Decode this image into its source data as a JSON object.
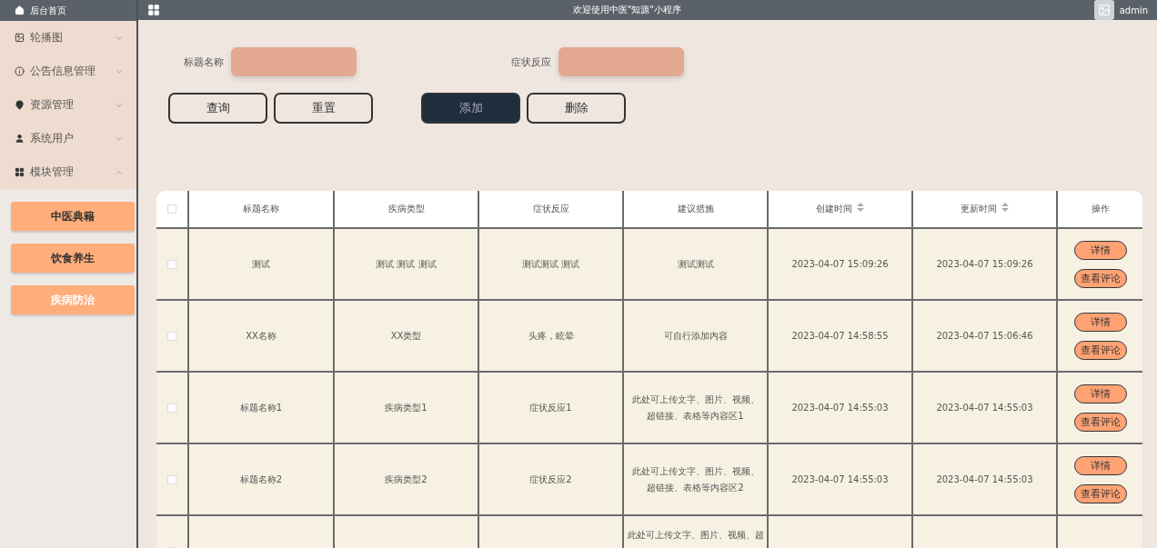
{
  "sidebar": {
    "home": "后台首页",
    "menus": [
      {
        "label": "轮播图",
        "expanded": false
      },
      {
        "label": "公告信息管理",
        "expanded": false
      },
      {
        "label": "资源管理",
        "expanded": false
      },
      {
        "label": "系统用户",
        "expanded": false
      },
      {
        "label": "模块管理",
        "expanded": true,
        "children": [
          {
            "label": "中医典籍",
            "selected": false
          },
          {
            "label": "饮食养生",
            "selected": false
          },
          {
            "label": "疾病防治",
            "selected": true
          }
        ]
      }
    ]
  },
  "header": {
    "title": "欢迎使用中医\"知源\"小程序",
    "user": "admin"
  },
  "search": {
    "fields": [
      {
        "label": "标题名称"
      },
      {
        "label": "症状反应"
      }
    ],
    "buttons": [
      "查询",
      "重置"
    ],
    "actions": [
      "添加",
      "删除"
    ]
  },
  "table": {
    "all_checked": false,
    "columns": [
      {
        "label": "标题名称",
        "sortable": false
      },
      {
        "label": "疾病类型",
        "sortable": false
      },
      {
        "label": "症状反应",
        "sortable": false
      },
      {
        "label": "建议措施",
        "sortable": false
      },
      {
        "label": "创建时间",
        "sortable": true
      },
      {
        "label": "更新时间",
        "sortable": true
      },
      {
        "label": "操作",
        "sortable": false
      }
    ],
    "rows": [
      {
        "checked": false,
        "cells": [
          "测试",
          "测试 测试 测试",
          "测试测试 测试",
          "测试测试",
          "2023-04-07 15:09:26",
          "2023-04-07 15:09:26"
        ],
        "actions": [
          "详情",
          "查看评论"
        ]
      },
      {
        "checked": false,
        "cells": [
          "XX名称",
          "XX类型",
          "头疼，眩晕",
          "可自行添加内容",
          "2023-04-07 14:58:55",
          "2023-04-07 15:06:46"
        ],
        "actions": [
          "详情",
          "查看评论"
        ]
      },
      {
        "checked": false,
        "cells": [
          "标题名称1",
          "疾病类型1",
          "症状反应1",
          "此处可上传文字、图片、视频、超链接、表格等内容区1",
          "2023-04-07 14:55:03",
          "2023-04-07 14:55:03"
        ],
        "actions": [
          "详情",
          "查看评论"
        ]
      },
      {
        "checked": false,
        "cells": [
          "标题名称2",
          "疾病类型2",
          "症状反应2",
          "此处可上传文字、图片、视频、超链接、表格等内容区2",
          "2023-04-07 14:55:03",
          "2023-04-07 14:55:03"
        ],
        "actions": [
          "详情",
          "查看评论"
        ]
      },
      {
        "checked": false,
        "cells": [
          null,
          null,
          null,
          "此处可上传文字、图片、视频、超",
          null,
          null
        ]
      }
    ]
  }
}
